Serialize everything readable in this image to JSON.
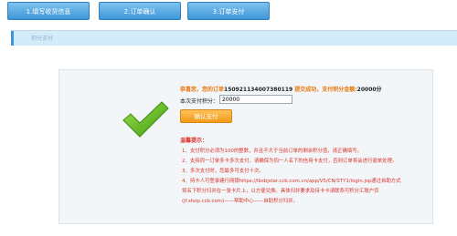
{
  "steps": [
    {
      "label": "1.填写收货信息"
    },
    {
      "label": "2.订单确认"
    },
    {
      "label": "3.订单支付"
    }
  ],
  "section": {
    "title": "积分支付"
  },
  "result": {
    "greeting": "恭喜您，您的订单",
    "order_no": "1509211340073801​19",
    "success_text": "提交成功，支付积分金额:",
    "points_amount": "20000分"
  },
  "pay": {
    "label": "本次支付积分：",
    "value": "20000",
    "button": "确认支付"
  },
  "tips": {
    "title": "温馨提示：",
    "items": [
      "1、支付积分必须为100的整数，并且不大于当前订单的剩余积分值，请正确填写。",
      "2、支持同一订单多卡多次支付，请确保为同一人名下的信用卡支付，否则订单将会进行退单处理。",
      "3、多次支付时，您最多可支付十次。",
      "4、持卡人可登录建行网银https://ibsbjstar.ccb.com.cn/app/V5/CN/STY1/login.jsp通过自助方式",
      "将名下积分归并在一张卡片上，以方便兑换。具体归并要求及持卡卡请联系可积分汇账户页",
      "(jf.shop.ccb.com)——帮助中心——自助积分归并。"
    ]
  },
  "colors": {
    "accent": "#e8770e",
    "tip": "#d9342b",
    "tab": "#3f95d7",
    "check": "#6cbd1f"
  }
}
